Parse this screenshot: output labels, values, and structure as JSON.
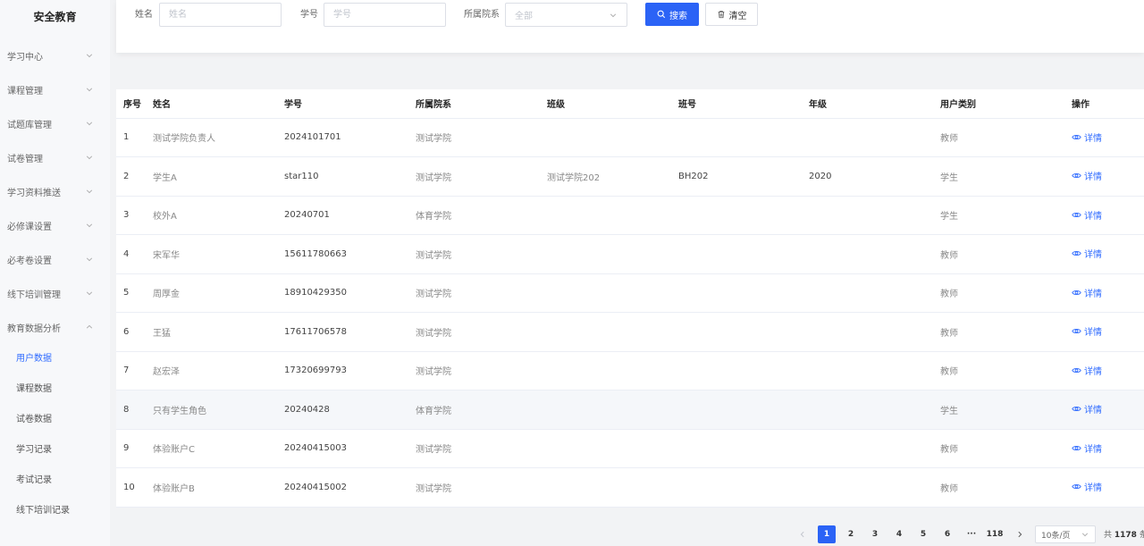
{
  "sidebar": {
    "brand": "安全教育",
    "items": [
      {
        "label": "学习中心"
      },
      {
        "label": "课程管理"
      },
      {
        "label": "试题库管理"
      },
      {
        "label": "试卷管理"
      },
      {
        "label": "学习资料推送"
      },
      {
        "label": "必修课设置"
      },
      {
        "label": "必考卷设置"
      },
      {
        "label": "线下培训管理"
      },
      {
        "label": "教育数据分析"
      }
    ],
    "subitems": [
      {
        "label": "用户数据"
      },
      {
        "label": "课程数据"
      },
      {
        "label": "试卷数据"
      },
      {
        "label": "学习记录"
      },
      {
        "label": "考试记录"
      },
      {
        "label": "线下培训记录"
      }
    ],
    "active_subitem": "用户数据"
  },
  "filters": {
    "name_label": "姓名",
    "name_placeholder": "姓名",
    "id_label": "学号",
    "id_placeholder": "学号",
    "dept_label": "所属院系",
    "dept_value": "全部",
    "search_label": "搜索",
    "clear_label": "清空"
  },
  "table": {
    "headers": [
      "序号",
      "姓名",
      "学号",
      "所属院系",
      "班级",
      "班号",
      "年级",
      "用户类别",
      "操作"
    ],
    "action_label": "详情",
    "rows": [
      {
        "idx": "1",
        "name": "测试学院负责人",
        "id": "2024101701",
        "dept": "测试学院",
        "class": "",
        "class_no": "",
        "grade": "",
        "type": "教师"
      },
      {
        "idx": "2",
        "name": "学生A",
        "id": "star110",
        "dept": "测试学院",
        "class": "测试学院202",
        "class_no": "BH202",
        "grade": "2020",
        "type": "学生"
      },
      {
        "idx": "3",
        "name": "校外A",
        "id": "20240701",
        "dept": "体育学院",
        "class": "",
        "class_no": "",
        "grade": "",
        "type": "学生"
      },
      {
        "idx": "4",
        "name": "宋军华",
        "id": "15611780663",
        "dept": "测试学院",
        "class": "",
        "class_no": "",
        "grade": "",
        "type": "教师"
      },
      {
        "idx": "5",
        "name": "周厚金",
        "id": "18910429350",
        "dept": "测试学院",
        "class": "",
        "class_no": "",
        "grade": "",
        "type": "教师"
      },
      {
        "idx": "6",
        "name": "王猛",
        "id": "17611706578",
        "dept": "测试学院",
        "class": "",
        "class_no": "",
        "grade": "",
        "type": "教师"
      },
      {
        "idx": "7",
        "name": "赵宏泽",
        "id": "17320699793",
        "dept": "测试学院",
        "class": "",
        "class_no": "",
        "grade": "",
        "type": "教师"
      },
      {
        "idx": "8",
        "name": "只有学生角色",
        "id": "20240428",
        "dept": "体育学院",
        "class": "",
        "class_no": "",
        "grade": "",
        "type": "学生"
      },
      {
        "idx": "9",
        "name": "体验账户C",
        "id": "20240415003",
        "dept": "测试学院",
        "class": "",
        "class_no": "",
        "grade": "",
        "type": "教师"
      },
      {
        "idx": "10",
        "name": "体验账户B",
        "id": "20240415002",
        "dept": "测试学院",
        "class": "",
        "class_no": "",
        "grade": "",
        "type": "教师"
      }
    ]
  },
  "pagination": {
    "pages": [
      "1",
      "2",
      "3",
      "4",
      "5",
      "6"
    ],
    "ellipsis": "···",
    "last_page": "118",
    "current": "1",
    "page_size": "10条/页",
    "total_prefix": "共",
    "total_count": "1178",
    "total_suffix": "条"
  },
  "colors": {
    "accent": "#2b63f6",
    "link": "#2f6bff"
  }
}
